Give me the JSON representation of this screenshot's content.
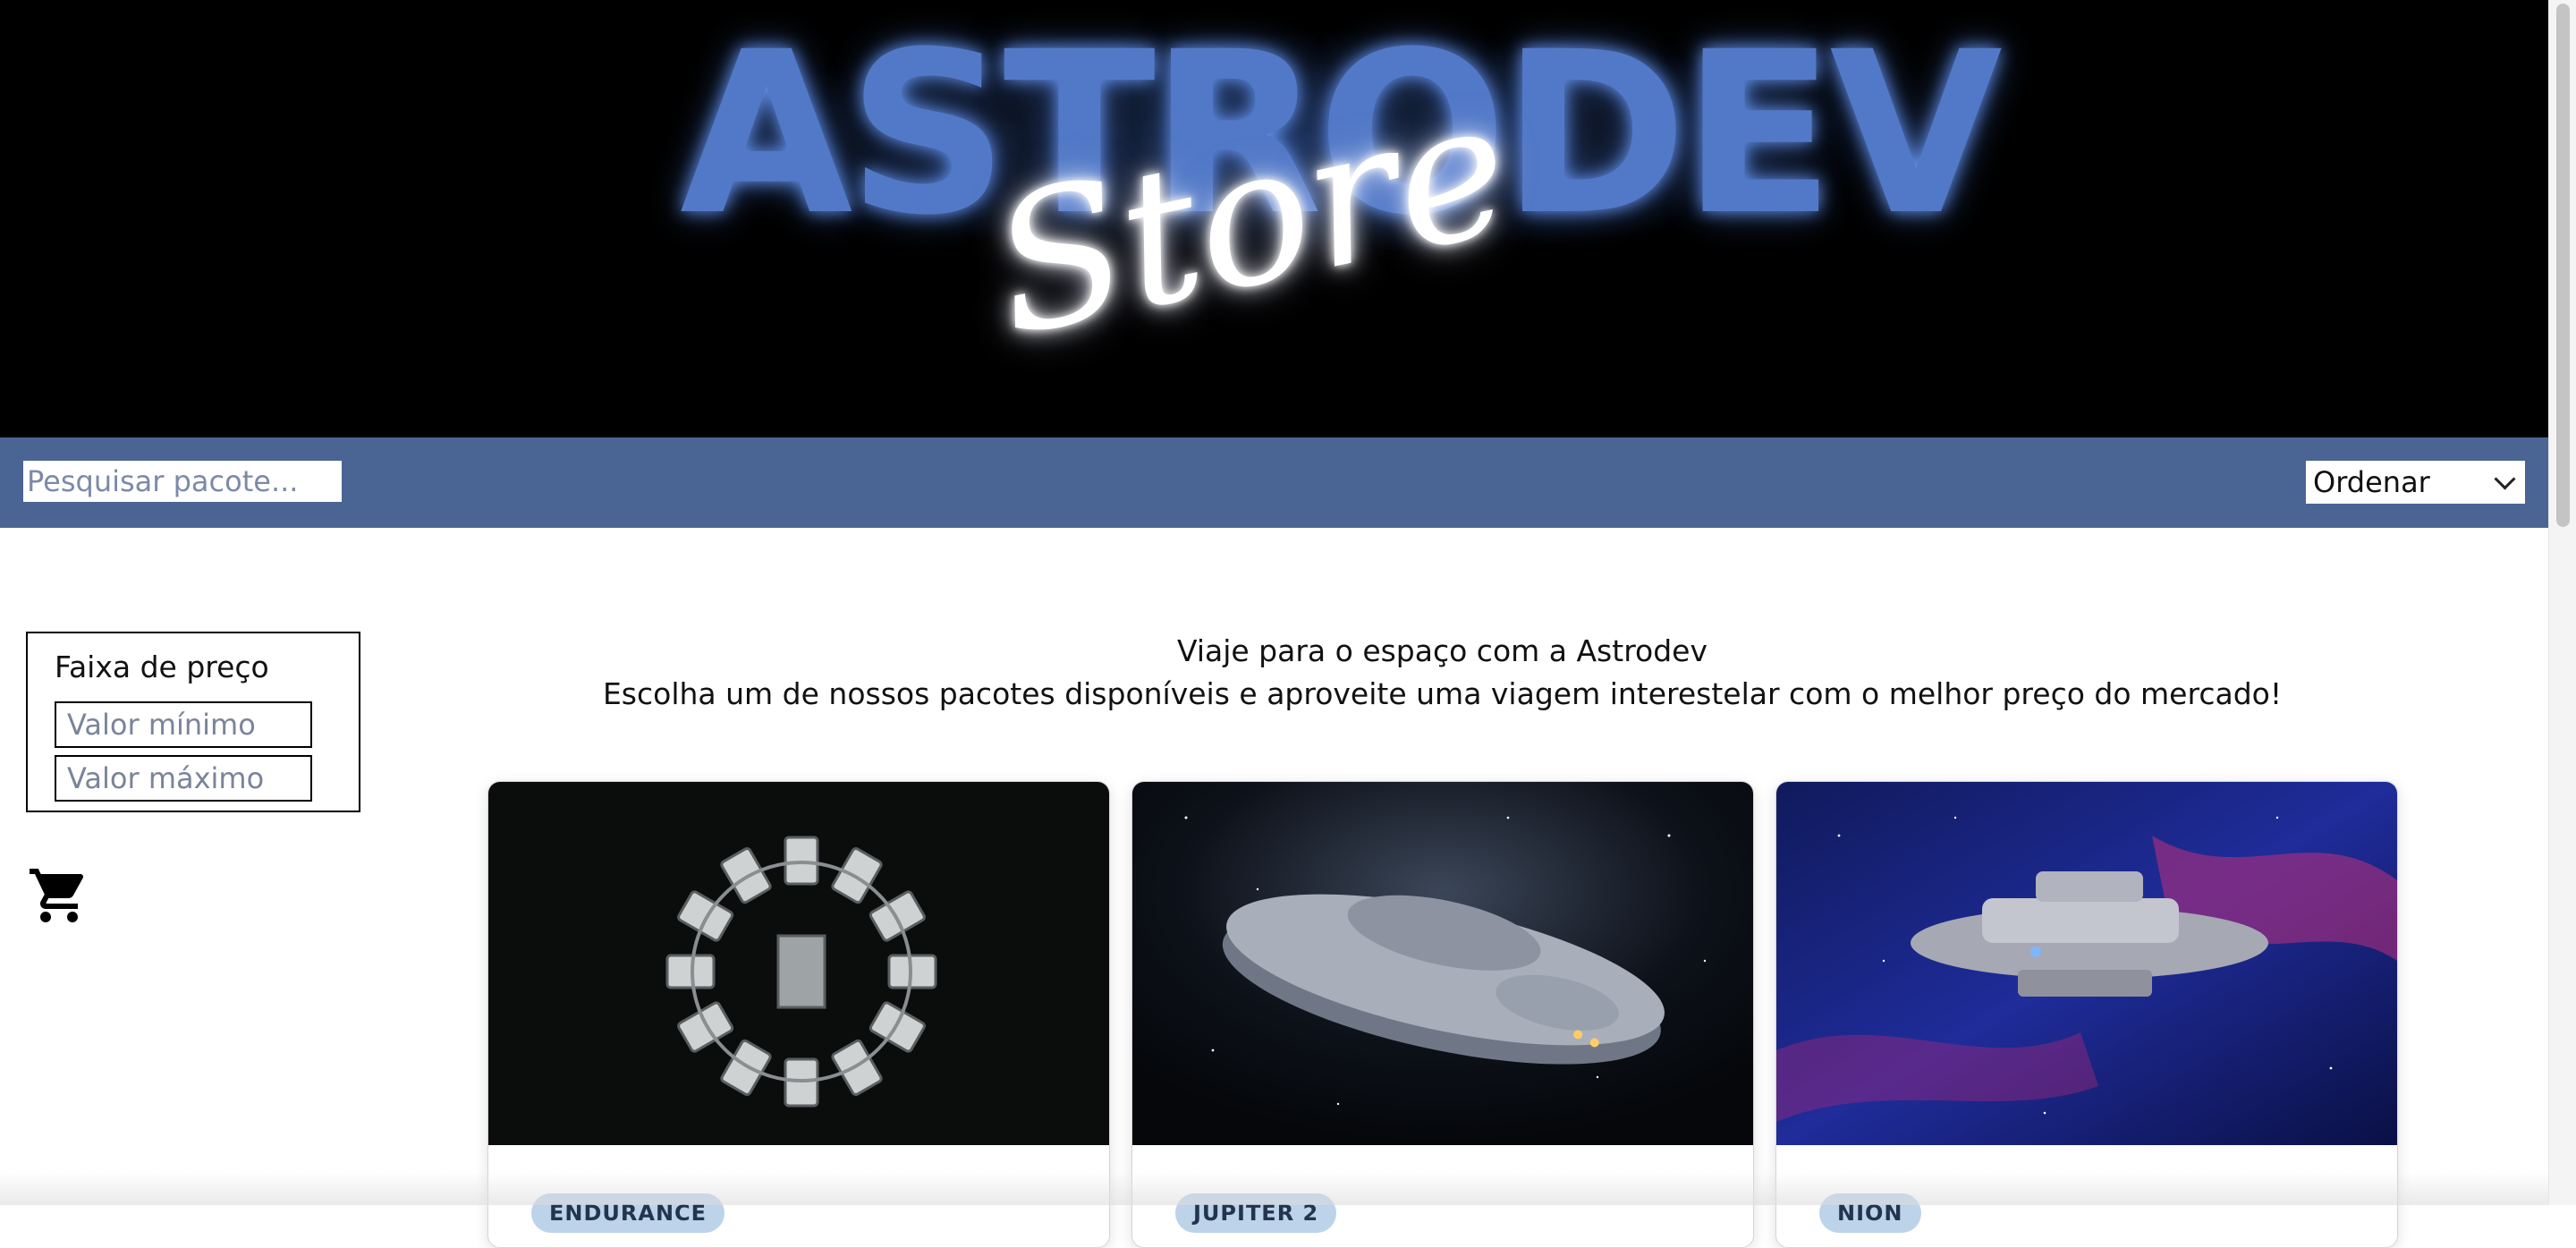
{
  "hero": {
    "brand_main": "ASTRODEV",
    "brand_script": "Store"
  },
  "toolbar": {
    "search_placeholder": "Pesquisar pacote...",
    "sort_label": "Ordenar"
  },
  "filters": {
    "title": "Faixa de preço",
    "min_placeholder": "Valor mínimo",
    "max_placeholder": "Valor máximo"
  },
  "cart": {
    "icon": "shopping-cart-icon"
  },
  "intro": {
    "line1": "Viaje para o espaço com a Astrodev",
    "line2": "Escolha um de nossos pacotes disponíveis e aproveite uma viagem interestelar com o melhor preço do mercado!"
  },
  "products": [
    {
      "badge": "ENDURANCE"
    },
    {
      "badge": "JUPITER 2"
    },
    {
      "badge": "NION"
    }
  ],
  "colors": {
    "toolbar_bg": "#4a6594",
    "brand_blue": "#5279c7",
    "badge_bg": "#bcd3ea"
  }
}
